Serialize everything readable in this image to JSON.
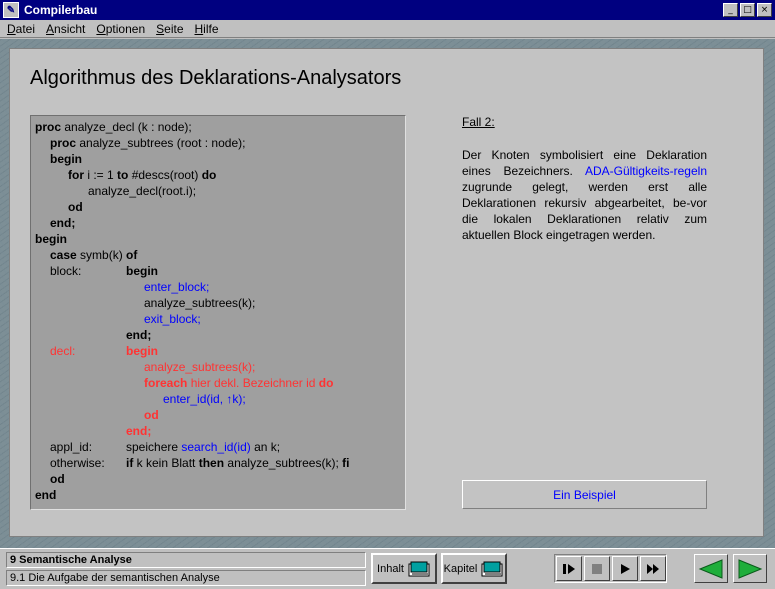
{
  "window": {
    "title": "Compilerbau",
    "btn_min": "_",
    "btn_max": "□",
    "btn_close": "×",
    "icon": "app-logo-icon"
  },
  "menu": [
    {
      "label": "Datei",
      "ul": "D",
      "rest": "atei"
    },
    {
      "label": "Ansicht",
      "ul": "A",
      "rest": "nsicht"
    },
    {
      "label": "Optionen",
      "ul": "O",
      "rest": "ptionen"
    },
    {
      "label": "Seite",
      "ul": "S",
      "rest": "eite"
    },
    {
      "label": "Hilfe",
      "ul": "H",
      "rest": "ilfe"
    }
  ],
  "page": {
    "title": "Algorithmus des Deklarations-Analysators",
    "code": {
      "l1a": "proc",
      "l1b": " analyze_decl (k : node);",
      "l2a": "proc",
      "l2b": " analyze_subtrees (root : node);",
      "l3": "begin",
      "l4a": "for",
      "l4b": " i := 1 ",
      "l4c": "to",
      "l4d": " #descs(root) ",
      "l4e": "do",
      "l5": "analyze_decl(root.i);",
      "l6": "od",
      "l7": "end;",
      "l8": "begin",
      "l9a": "case",
      "l9b": " symb(k) ",
      "l9c": "of",
      "l10a": "block:",
      "l10b": "begin",
      "l11": "enter_block;",
      "l12": "analyze_subtrees(k);",
      "l13": "exit_block;",
      "l14": "end;",
      "l15a": "decl:",
      "l15b": "begin",
      "l16": "analyze_subtrees(k);",
      "l17a": "foreach",
      "l17b": " hier dekl. Bezeichner id ",
      "l17c": "do",
      "l18": "enter_id(id, ↑k);",
      "l19": "od",
      "l20": "end;",
      "l21a": "appl_id:",
      "l21b": "speichere ",
      "l21c": "search_id(id)",
      "l21d": " an k;",
      "l22a": "otherwise:",
      "l22b": "if",
      "l22c": " k kein Blatt ",
      "l22d": "then",
      "l22e": " analyze_subtrees(k); ",
      "l22f": "fi",
      "l23": "od",
      "l24": "end"
    },
    "case_title": "Fall 2:",
    "desc_1": "Der Knoten symbolisiert eine Deklaration eines Bezeichners. ",
    "desc_link": "ADA-Gültigkeits-regeln",
    "desc_2": " zugrunde gelegt, werden erst alle Deklarationen rekursiv abgearbeitet, be-vor die lokalen Deklarationen relativ zum aktuellen Block eingetragen werden.",
    "example_button": "Ein Beispiel"
  },
  "status": {
    "chapter": "9 Semantische Analyse",
    "section": "9.1 Die Aufgabe der semantischen Analyse",
    "inhalt": "Inhalt",
    "kapitel": "Kapitel"
  },
  "colors": {
    "accent_blue": "#0000ff",
    "highlight_red": "#ff3333",
    "arrow_green": "#1fae3b",
    "title_bar": "#000080"
  }
}
